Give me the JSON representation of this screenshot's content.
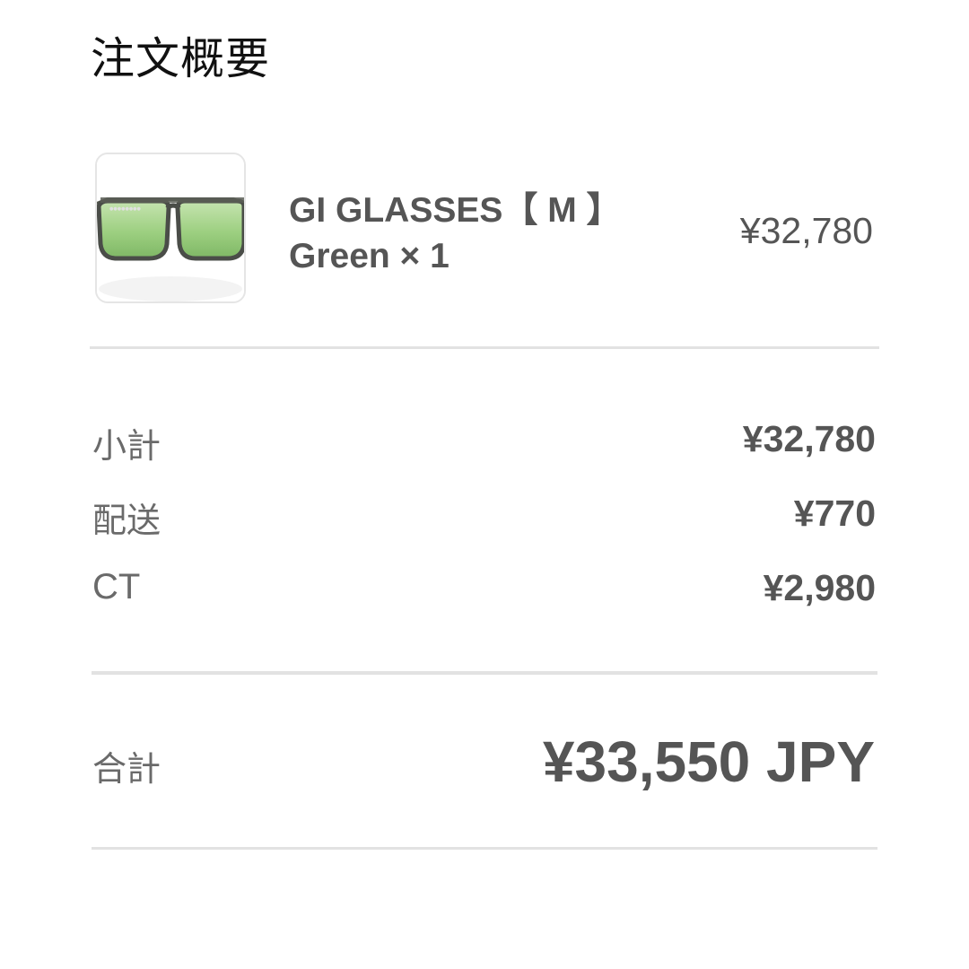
{
  "title": "注文概要",
  "product": {
    "image_icon": "sunglasses-product-image",
    "name": "GI GLASSES【 M 】",
    "variant": "Green × 1",
    "price": "¥32,780"
  },
  "summary": {
    "rows": [
      {
        "label": "小計",
        "value": "¥32,780"
      },
      {
        "label": "配送",
        "value": "¥770"
      },
      {
        "label": "CT",
        "value": "¥2,980"
      }
    ]
  },
  "total": {
    "label": "合計",
    "value": "¥33,550 JPY"
  },
  "colors": {
    "text": "#555555",
    "label": "#6a6a6a",
    "divider": "#e2e2e2",
    "lens": "#9ccf80",
    "frame": "#4a4d48"
  }
}
